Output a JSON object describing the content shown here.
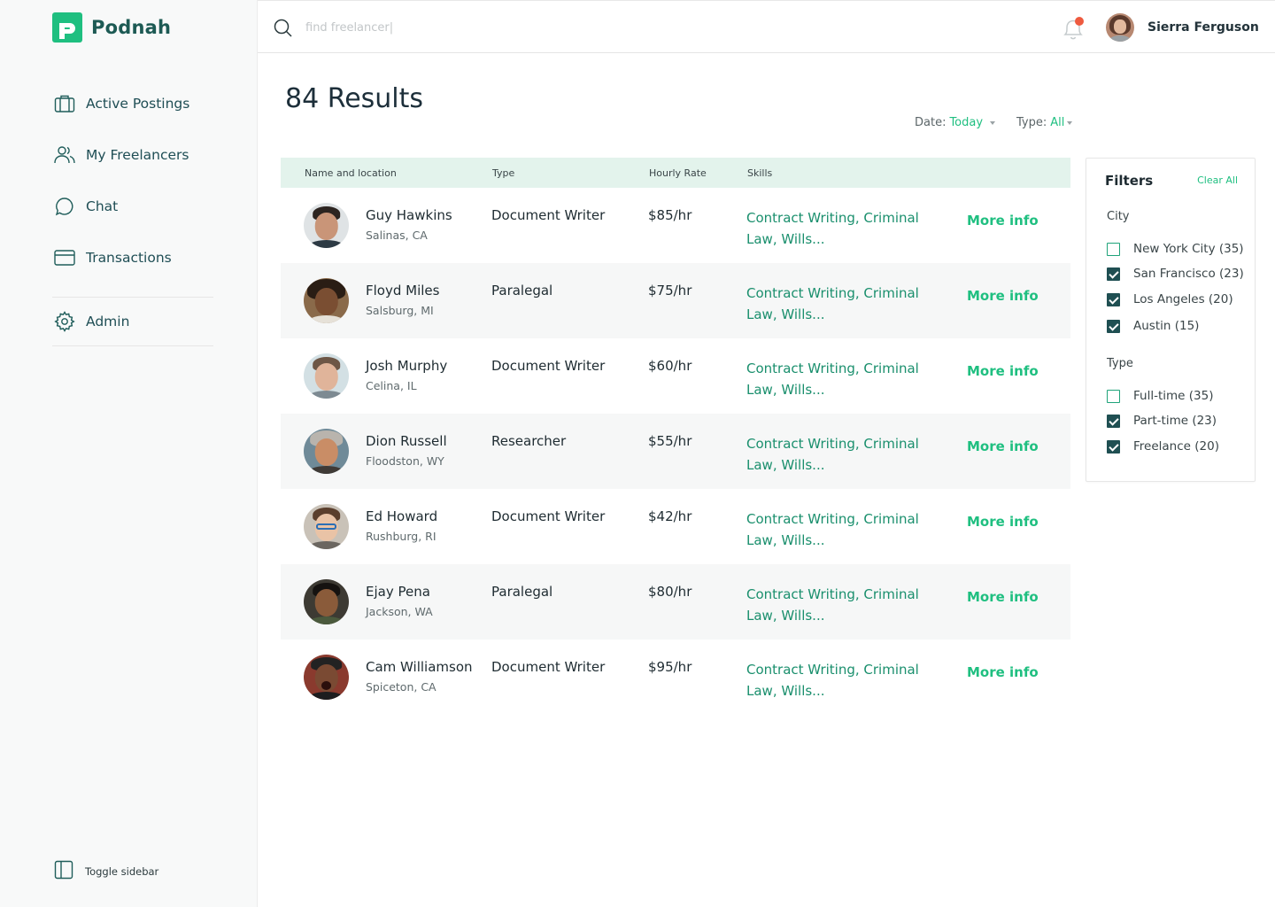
{
  "app": {
    "name": "Podnah"
  },
  "sidebar": {
    "items": [
      {
        "label": "Active Postings",
        "icon": "briefcase-icon"
      },
      {
        "label": "My Freelancers",
        "icon": "users-icon"
      },
      {
        "label": "Chat",
        "icon": "chat-bubble-icon"
      },
      {
        "label": "Transactions",
        "icon": "credit-card-icon"
      }
    ],
    "admin": {
      "label": "Admin",
      "icon": "gear-icon"
    },
    "toggle_label": "Toggle sidebar"
  },
  "search": {
    "placeholder": "find freelancer|"
  },
  "user": {
    "name": "Sierra Ferguson"
  },
  "main": {
    "results_title": "84 Results",
    "date_sort": {
      "label": "Date:",
      "value": "Today"
    },
    "type_sort": {
      "label": "Type:",
      "value": "All"
    }
  },
  "table": {
    "columns": [
      "Name and location",
      "Type",
      "Hourly Rate",
      "Skills"
    ],
    "rows": [
      {
        "name": "Guy Hawkins",
        "location": "Salinas, CA",
        "type": "Document Writer",
        "rate": "$85/hr",
        "skills": "Contract Writing, Criminal Law, Wills...",
        "action": "More info"
      },
      {
        "name": "Floyd Miles",
        "location": "Salsburg, MI",
        "type": "Paralegal",
        "rate": "$75/hr",
        "skills": "Contract Writing, Criminal Law, Wills...",
        "action": "More info"
      },
      {
        "name": "Josh Murphy",
        "location": "Celina, IL",
        "type": "Document Writer",
        "rate": "$60/hr",
        "skills": "Contract Writing, Criminal Law, Wills...",
        "action": "More info"
      },
      {
        "name": "Dion Russell",
        "location": "Floodston, WY",
        "type": "Researcher",
        "rate": "$55/hr",
        "skills": "Contract Writing, Criminal Law, Wills...",
        "action": "More info"
      },
      {
        "name": "Ed Howard",
        "location": "Rushburg, RI",
        "type": "Document Writer",
        "rate": "$42/hr",
        "skills": "Contract Writing, Criminal Law, Wills...",
        "action": "More info"
      },
      {
        "name": "Ejay Pena",
        "location": "Jackson, WA",
        "type": "Paralegal",
        "rate": "$80/hr",
        "skills": "Contract Writing, Criminal Law, Wills...",
        "action": "More info"
      },
      {
        "name": "Cam Williamson",
        "location": "Spiceton, CA",
        "type": "Document Writer",
        "rate": "$95/hr",
        "skills": "Contract Writing, Criminal Law, Wills...",
        "action": "More info"
      }
    ]
  },
  "filters": {
    "title": "Filters",
    "clear_label": "Clear All",
    "city": {
      "label": "City",
      "options": [
        {
          "label": "New York City (35)",
          "checked": false
        },
        {
          "label": "San Francisco (23)",
          "checked": true
        },
        {
          "label": "Los Angeles (20)",
          "checked": true
        },
        {
          "label": "Austin (15)",
          "checked": true
        }
      ]
    },
    "type": {
      "label": "Type",
      "options": [
        {
          "label": "Full-time (35)",
          "checked": false
        },
        {
          "label": "Part-time (23)",
          "checked": true
        },
        {
          "label": "Freelance (20)",
          "checked": true
        }
      ]
    }
  },
  "colors": {
    "accent": "#1fbf80",
    "brand_dark": "#1d5a54",
    "header_bg": "#e3f3ec",
    "notification": "#ee5a3f"
  }
}
